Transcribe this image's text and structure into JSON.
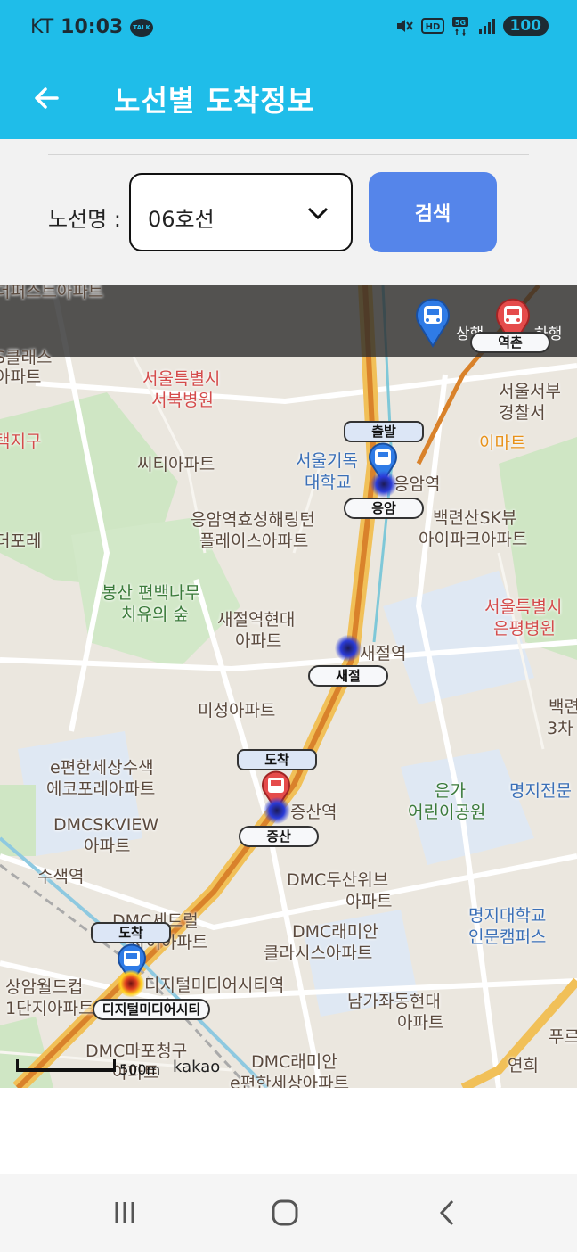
{
  "status_bar": {
    "carrier": "KT",
    "time": "10:03",
    "talk": "TALK",
    "battery": "100"
  },
  "header": {
    "title": "노선별 도착정보"
  },
  "search": {
    "route_label": "노선명 :",
    "route_value": "06호선",
    "search_button": "검색"
  },
  "map": {
    "legend": {
      "up_label": "상행",
      "down_label": "하행"
    },
    "places": [
      "서울특별시",
      "서북병원",
      "서울서부",
      "경찰서",
      "이마트",
      "씨티아파트",
      "서울기독",
      "대학교",
      "응암역",
      "응암역효성해링턴",
      "플레이스아파트",
      "백련산SK뷰",
      "아이파크아파트",
      "봉산 편백나무",
      "치유의 숲",
      "서울특별시",
      "은평병원",
      "새절역현대",
      "아파트",
      "새절역",
      "미성아파트",
      "e편한세상수색",
      "에코포레아파트",
      "증산역",
      "은가",
      "어린이공원",
      "명지전문",
      "DMCSKVIEW",
      "아파트",
      "수색역",
      "DMC두산위브",
      "아파트",
      "명지대학교",
      "인문캠퍼스",
      "DMC세트럴",
      "자이아파트",
      "DMC래미안",
      "클라시스아파트",
      "디지털미디어시티역",
      "상암월드컵",
      "1단지아파트",
      "남가좌동현대",
      "아파트",
      "DMC마포청구",
      "아파트",
      "DMC래미안",
      "e편한세상아파트",
      "연희",
      "푸르",
      "백련",
      "3차",
      "더포레",
      "S클래스",
      "아파트",
      "택지구",
      "더퍼스트아파트"
    ],
    "stops": {
      "eungam": "응암",
      "saejeol": "새절",
      "jeungsan": "증산",
      "dmc": "디지털미디어시티",
      "yeok": "역촌"
    },
    "tags": {
      "start": "출발",
      "arrive1": "도착",
      "arrive2": "도착"
    },
    "scale": "500m",
    "attribution": "kakao",
    "colors": {
      "up_marker": "#2f7be6",
      "down_marker": "#e54b4b",
      "route_line": "#d9822b"
    }
  }
}
